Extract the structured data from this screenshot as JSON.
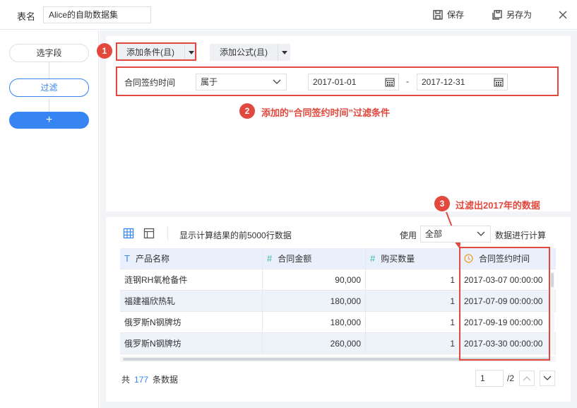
{
  "header": {
    "table_name_label": "表名",
    "table_name_value": "Alice的自助数据集",
    "save_label": "保存",
    "save_as_label": "另存为"
  },
  "steps": {
    "select_fields": "选字段",
    "filter": "过滤",
    "add": "+"
  },
  "filter": {
    "add_condition": "添加条件(且)",
    "add_formula": "添加公式(且)",
    "condition_field": "合同签约时间",
    "operator": "属于",
    "start_date": "2017-01-01",
    "dash": "-",
    "end_date": "2017-12-31"
  },
  "annotations": {
    "badge1": "1",
    "badge2": "2",
    "text2": "添加的“合同签约时间”过滤条件",
    "badge3": "3",
    "text3": "过滤出2017年的数据"
  },
  "data_toolbar": {
    "preview_text": "显示计算结果的前5000行数据",
    "use_label": "使用",
    "use_value": "全部",
    "use_suffix": "数据进行计算"
  },
  "table": {
    "columns": [
      {
        "type_symbol": "T",
        "label": "产品名称"
      },
      {
        "type_symbol": "#",
        "label": "合同金额"
      },
      {
        "type_symbol": "#",
        "label": "购买数量"
      },
      {
        "type_symbol": "clock",
        "label": "合同签约时间"
      }
    ],
    "rows": [
      [
        "涟钢RH氧枪备件",
        "90,000",
        "1",
        "2017-03-07 00:00:00"
      ],
      [
        "福建福欣热轧",
        "180,000",
        "1",
        "2017-07-09 00:00:00"
      ],
      [
        "俄罗斯N钢牌坊",
        "180,000",
        "1",
        "2017-09-19 00:00:00"
      ],
      [
        "俄罗斯N钢牌坊",
        "260,000",
        "1",
        "2017-03-30 00:00:00"
      ]
    ]
  },
  "footer": {
    "total_prefix": "共",
    "total_count": "177",
    "total_suffix": "条数据",
    "current_page": "1",
    "total_pages": "/2"
  },
  "colors": {
    "accent": "#3685f2",
    "annotation_red": "#e2483d",
    "number_type": "#3cb8a5",
    "date_type": "#f0a030"
  }
}
